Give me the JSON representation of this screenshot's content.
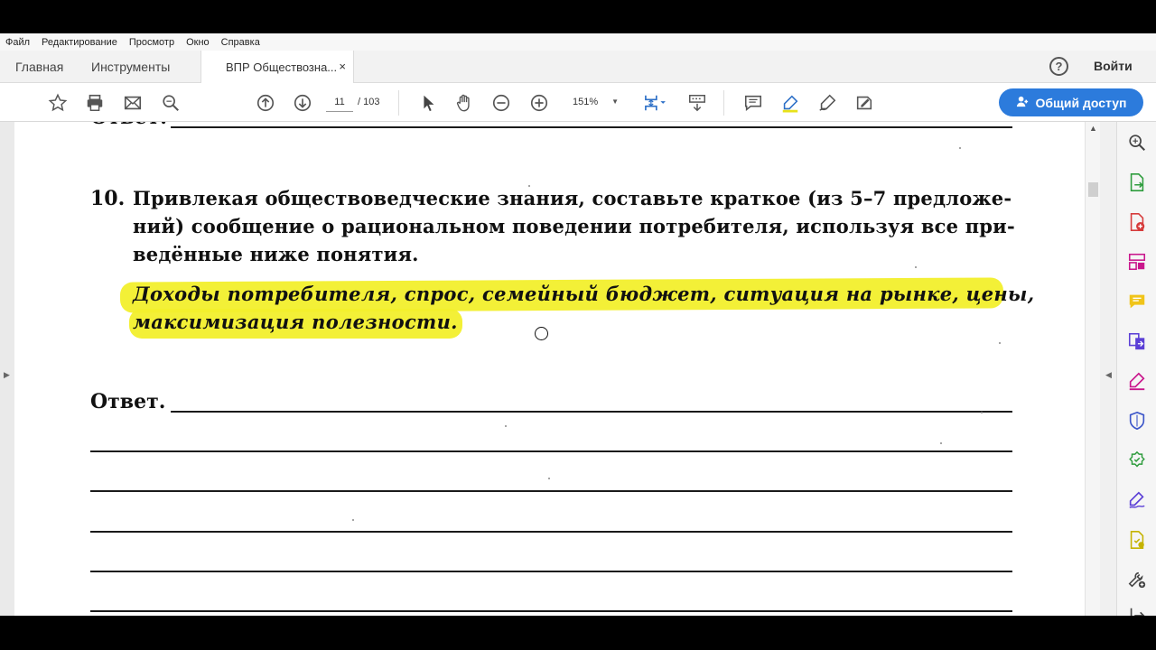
{
  "menu": [
    "Файл",
    "Редактирование",
    "Просмотр",
    "Окно",
    "Справка"
  ],
  "tabs": {
    "home": "Главная",
    "tools": "Инструменты",
    "document": "ВПР Обществозна...",
    "close": "×"
  },
  "header": {
    "help": "?",
    "signin": "Войти"
  },
  "toolbar": {
    "page_current": "11",
    "page_total": "/ 103",
    "zoom": "151%",
    "share_label": "Общий доступ"
  },
  "document": {
    "prev_answer_label": "Ответ.",
    "task_number": "10.",
    "task_lines": [
      "Привлекая обществоведческие знания, составьте краткое (из 5–7 предложе-",
      "ний) сообщение о рациональном поведении потребителя, используя все при-",
      "ведённые ниже понятия."
    ],
    "concept_lines": [
      "Доходы потребителя, спрос, семейный бюджет, ситуация на рынке, цены,",
      "максимизация полезности."
    ],
    "answer_label": "Ответ."
  },
  "colors": {
    "highlight": "#f2ef2c",
    "share_button": "#2c7bdc",
    "accent_tools": "#c9168c"
  },
  "sidebar_icons": [
    "zoom-doc-icon",
    "export-pdf-icon",
    "create-pdf-icon",
    "organize-pages-icon",
    "comment-icon",
    "combine-files-icon",
    "fill-sign-icon",
    "protect-icon",
    "optimize-pdf-icon",
    "request-signature-icon",
    "send-for-review-icon",
    "more-tools-icon",
    "expand-panel-icon"
  ]
}
